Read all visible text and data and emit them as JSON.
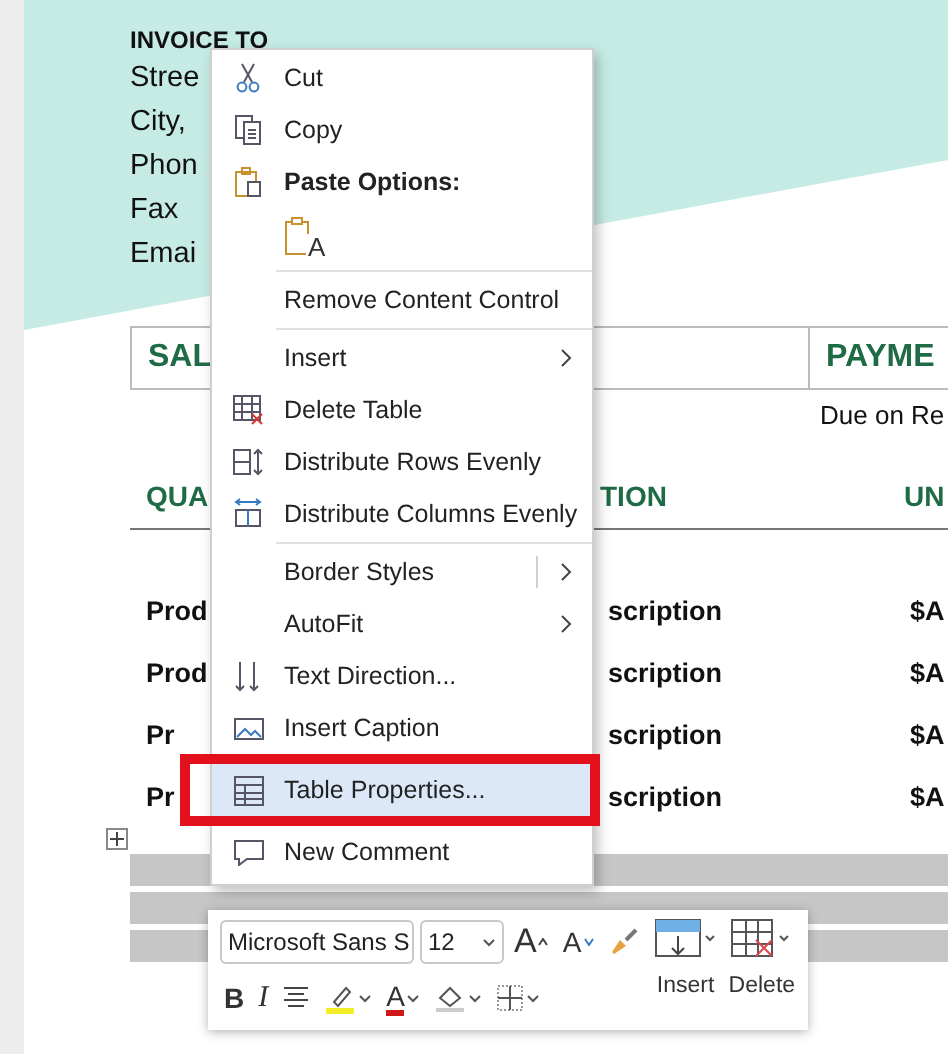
{
  "document": {
    "invoice_heading": "INVOICE TO",
    "address_lines": [
      "Stree",
      "City,",
      "Phon",
      "Fax",
      "Emai"
    ],
    "sales_header": "SAL",
    "payment_header": "PAYME",
    "payment_value": "Due on Re",
    "columns": [
      "QUA",
      "TION",
      "UN"
    ],
    "rows": [
      [
        "Prod",
        "scription",
        "$A"
      ],
      [
        "Prod",
        "scription",
        "$A"
      ],
      [
        "Pr",
        "scription",
        "$A"
      ],
      [
        "Pr",
        "scription",
        "$A"
      ]
    ]
  },
  "context_menu": {
    "items": [
      {
        "kind": "command",
        "label": "Cut",
        "divider_above": false,
        "selected": false
      },
      {
        "kind": "command",
        "label": "Copy",
        "divider_above": false,
        "selected": false
      },
      {
        "kind": "header",
        "label": "Paste Options:",
        "divider_above": false,
        "selected": false
      },
      {
        "kind": "paste",
        "label": "A",
        "divider_above": false,
        "selected": false
      },
      {
        "kind": "command",
        "label": "Remove Content Control",
        "divider_above": true,
        "selected": false
      },
      {
        "kind": "submenu",
        "label": "Insert",
        "divider_above": true,
        "selected": false
      },
      {
        "kind": "command",
        "label": "Delete Table",
        "divider_above": false,
        "selected": false
      },
      {
        "kind": "command",
        "label": "Distribute Rows Evenly",
        "divider_above": false,
        "selected": false
      },
      {
        "kind": "command",
        "label": "Distribute Columns Evenly",
        "divider_above": false,
        "selected": false
      },
      {
        "kind": "split_submenu",
        "label": "Border Styles",
        "divider_above": true,
        "selected": false
      },
      {
        "kind": "submenu",
        "label": "AutoFit",
        "divider_above": false,
        "selected": false
      },
      {
        "kind": "command",
        "label": "Text Direction...",
        "divider_above": false,
        "selected": false
      },
      {
        "kind": "command",
        "label": "Insert Caption",
        "divider_above": false,
        "selected": false
      },
      {
        "kind": "command",
        "label": "Table Properties...",
        "divider_above": false,
        "selected": true
      },
      {
        "kind": "command",
        "label": "New Comment",
        "divider_above": false,
        "selected": false
      }
    ]
  },
  "mini_toolbar": {
    "font": "Microsoft Sans S",
    "size": "12",
    "grow_font": "A",
    "shrink_font": "A",
    "bold": "B",
    "italic": "I",
    "font_color": "A",
    "insert": "Insert",
    "delete": "Delete"
  }
}
